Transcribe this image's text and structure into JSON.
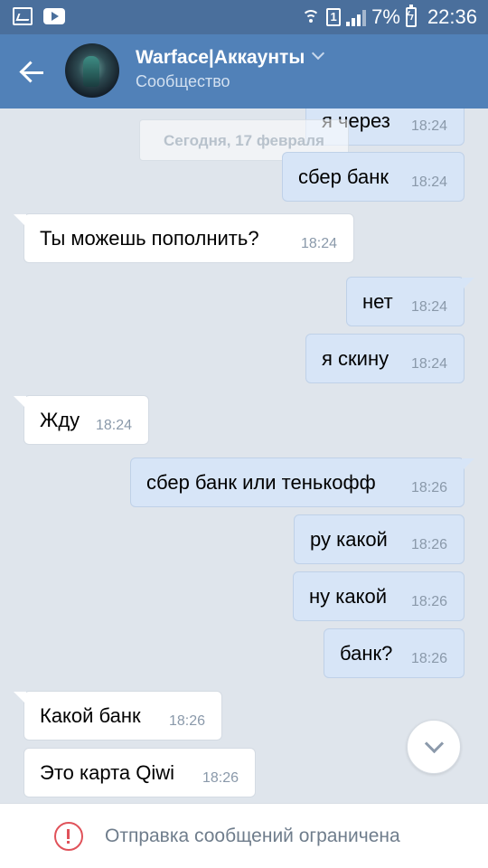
{
  "status_bar": {
    "battery": "7%",
    "time": "22:36",
    "sim": "1",
    "icons": [
      "gallery-icon",
      "youtube-icon",
      "wifi-icon",
      "sim-icon",
      "signal-icon",
      "battery-charging-icon"
    ]
  },
  "header": {
    "title": "Warface|Аккаунты",
    "subtitle": "Сообщество",
    "back_icon": "back-arrow-icon",
    "dropdown_icon": "chevron-down-icon"
  },
  "date_separator": "Сегодня, 17 февраля",
  "messages": [
    {
      "dir": "out",
      "text": "я через",
      "time": "18:24"
    },
    {
      "dir": "out",
      "text": "сбер банк",
      "time": "18:24"
    },
    {
      "dir": "in",
      "text": "Ты можешь пополнить?",
      "time": "18:24"
    },
    {
      "dir": "out",
      "text": "нет",
      "time": "18:24"
    },
    {
      "dir": "out",
      "text": "я скину",
      "time": "18:24"
    },
    {
      "dir": "in",
      "text": "Жду",
      "time": "18:24"
    },
    {
      "dir": "out",
      "text": "сбер банк или тенькофф",
      "time": "18:26"
    },
    {
      "dir": "out",
      "text": "ру какой",
      "time": "18:26"
    },
    {
      "dir": "out",
      "text": "ну какой",
      "time": "18:26"
    },
    {
      "dir": "out",
      "text": "банк?",
      "time": "18:26"
    },
    {
      "dir": "in",
      "text": "Какой банк",
      "time": "18:26"
    },
    {
      "dir": "in",
      "text": "Это карта Qiwi",
      "time": "18:26"
    }
  ],
  "footer": {
    "icon": "warning-circle-icon",
    "text": "Отправка сообщений ограничена"
  },
  "colors": {
    "status_bar": "#4a6f9c",
    "app_bar": "#5181b8",
    "background": "#dfe5ec",
    "outgoing_bubble": "#d7e5f7",
    "incoming_bubble": "#ffffff",
    "warning": "#e0525a"
  }
}
